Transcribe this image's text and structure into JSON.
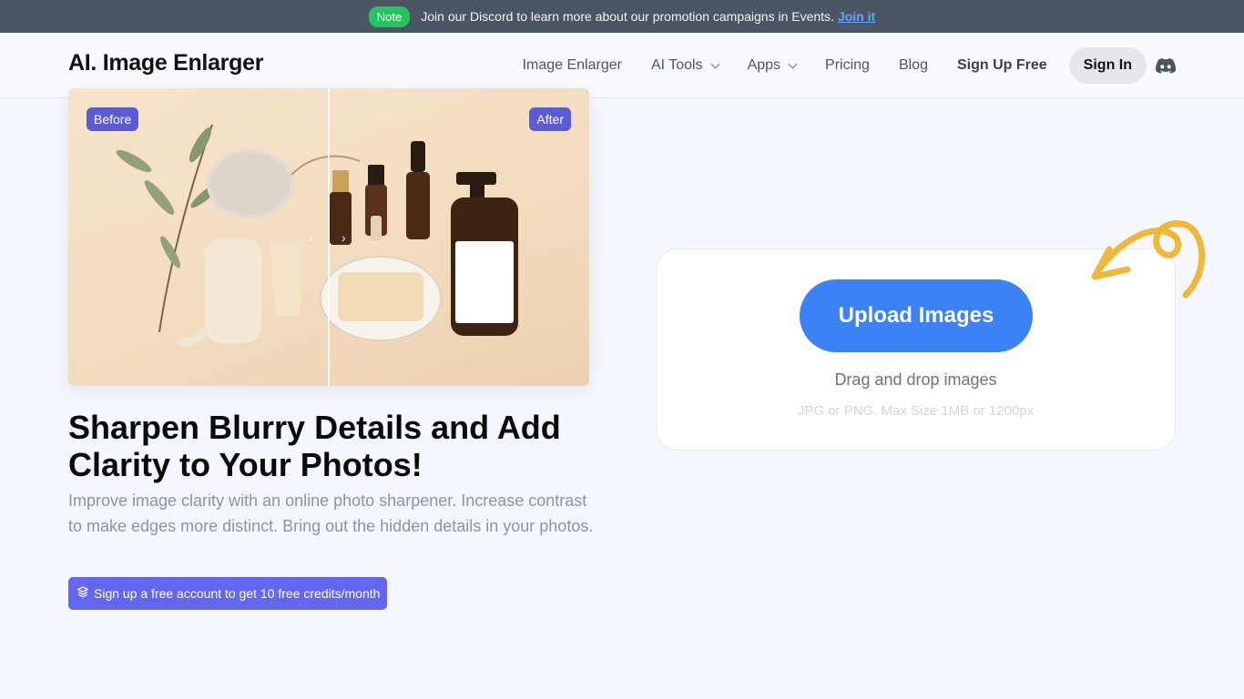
{
  "notice": {
    "badge": "Note",
    "message": "Join our Discord to learn more about our promotion campaigns in Events.",
    "link": "Join it"
  },
  "header": {
    "logo": "AI. Image Enlarger",
    "nav": {
      "image_enlarger": "Image Enlarger",
      "ai_tools": "AI Tools",
      "apps": "Apps",
      "pricing": "Pricing",
      "blog": "Blog",
      "sign_up": "Sign Up Free",
      "sign_in": "Sign In"
    }
  },
  "compare": {
    "before_label": "Before",
    "after_label": "After"
  },
  "hero": {
    "headline": "Sharpen Blurry Details and Add Clarity to Your Photos!",
    "subtext": "Improve image clarity with an online photo sharpener. Increase contrast to make edges more distinct. Bring out the hidden details in your photos.",
    "credits_button": "Sign up a free account to get 10 free credits/month"
  },
  "upload": {
    "button": "Upload Images",
    "drag_text": "Drag and drop images",
    "hint": "JPG or PNG. Max Size 1MB or 1200px"
  },
  "colors": {
    "accent_blue": "#3b82f6",
    "accent_indigo": "#6366f1",
    "note_green": "#22c55e",
    "arrow_yellow": "#efb83a"
  }
}
